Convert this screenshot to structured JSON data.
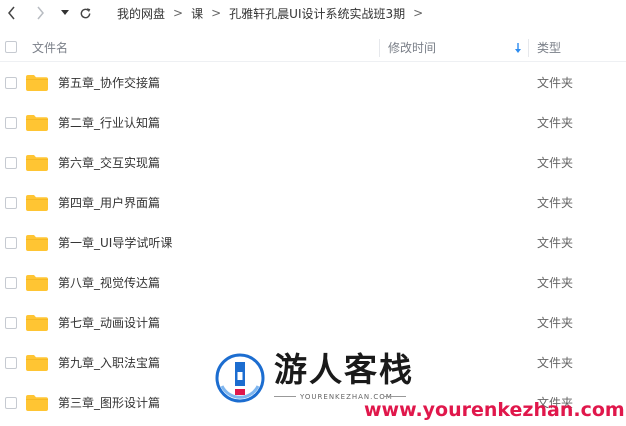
{
  "toolbar": {
    "back_icon": "chevron-left-icon",
    "forward_icon": "chevron-right-icon",
    "history_icon": "caret-down-icon",
    "refresh_icon": "refresh-icon"
  },
  "breadcrumb": [
    "我的网盘",
    "课",
    "孔雅轩孔晨UI设计系统实战班3期"
  ],
  "header": {
    "name": "文件名",
    "modified": "修改时间",
    "type": "类型",
    "sort_icon": "sort-down-arrow-icon"
  },
  "rows": [
    {
      "name": "第五章_协作交接篇",
      "type": "文件夹"
    },
    {
      "name": "第二章_行业认知篇",
      "type": "文件夹"
    },
    {
      "name": "第六章_交互实现篇",
      "type": "文件夹"
    },
    {
      "name": "第四章_用户界面篇",
      "type": "文件夹"
    },
    {
      "name": "第一章_UI导学试听课",
      "type": "文件夹"
    },
    {
      "name": "第八章_视觉传达篇",
      "type": "文件夹"
    },
    {
      "name": "第七章_动画设计篇",
      "type": "文件夹"
    },
    {
      "name": "第九章_入职法宝篇",
      "type": "文件夹"
    },
    {
      "name": "第三章_图形设计篇",
      "type": "文件夹"
    }
  ],
  "watermark": {
    "title": "游人客栈",
    "subtitle": "YOURENKEZHAN.COM",
    "url": "www.yourenkezhan.com"
  },
  "colors": {
    "folder": "#ffc533",
    "sort_arrow": "#2d8cf0",
    "watermark_url": "#e0174b",
    "logo_blue": "#1c6dd0"
  }
}
